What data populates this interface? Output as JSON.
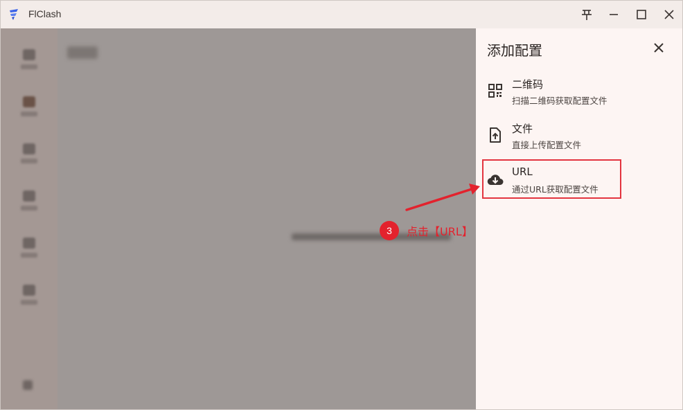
{
  "window": {
    "title": "FlClash",
    "controls": [
      "pin-icon",
      "minimize-icon",
      "maximize-icon",
      "close-icon"
    ]
  },
  "sheet": {
    "title": "添加配置",
    "options": [
      {
        "icon": "qr-code-icon",
        "title": "二维码",
        "subtitle": "扫描二维码获取配置文件"
      },
      {
        "icon": "upload-file-icon",
        "title": "文件",
        "subtitle": "直接上传配置文件"
      },
      {
        "icon": "cloud-download-icon",
        "title": "URL",
        "subtitle": "通过URL获取配置文件"
      }
    ]
  },
  "annotation": {
    "step": "3",
    "text": "点击【URL】"
  },
  "colors": {
    "sheet_bg": "#fdf5f3",
    "scrim": "#9e9896",
    "highlight": "#e3343f",
    "accent_logo": "#3b63e8"
  }
}
